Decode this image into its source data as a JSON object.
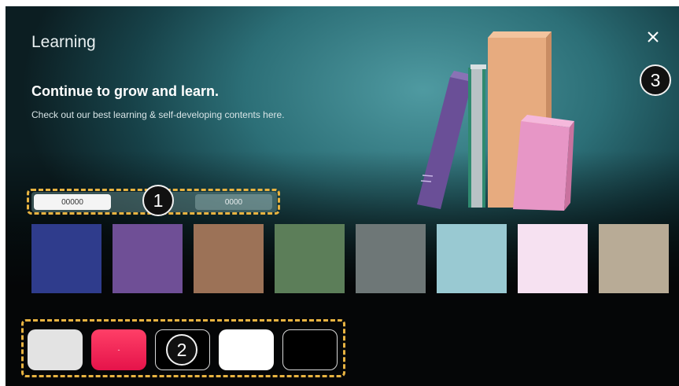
{
  "header": {
    "title": "Learning",
    "headline": "Continue to grow and learn.",
    "description": "Check out our best learning & self-developing contents here."
  },
  "close": {
    "icon": "close-icon"
  },
  "tabs": [
    {
      "label": "00000",
      "selected": true
    },
    {
      "label": "0000",
      "selected": false
    }
  ],
  "swatches": [
    {
      "color": "#2f3c8c"
    },
    {
      "color": "#6f4f96"
    },
    {
      "color": "#9c7257"
    },
    {
      "color": "#5c7e59"
    },
    {
      "color": "#6e7777"
    },
    {
      "color": "#99c9d2"
    },
    {
      "color": "#f6e1f1"
    },
    {
      "color": "#b8ab96"
    }
  ],
  "bottom_tiles": [
    {
      "color": "#e3e3e3",
      "label": ""
    },
    {
      "color": "#f1275a",
      "label": "-"
    },
    {
      "color": "#000000",
      "label": ""
    },
    {
      "color": "#ffffff",
      "label": ""
    },
    {
      "color": "#000000",
      "label": ""
    }
  ],
  "callouts": [
    "1",
    "2",
    "3"
  ],
  "colors": {
    "highlight": "#e8b341",
    "background": "#2c6f77"
  }
}
